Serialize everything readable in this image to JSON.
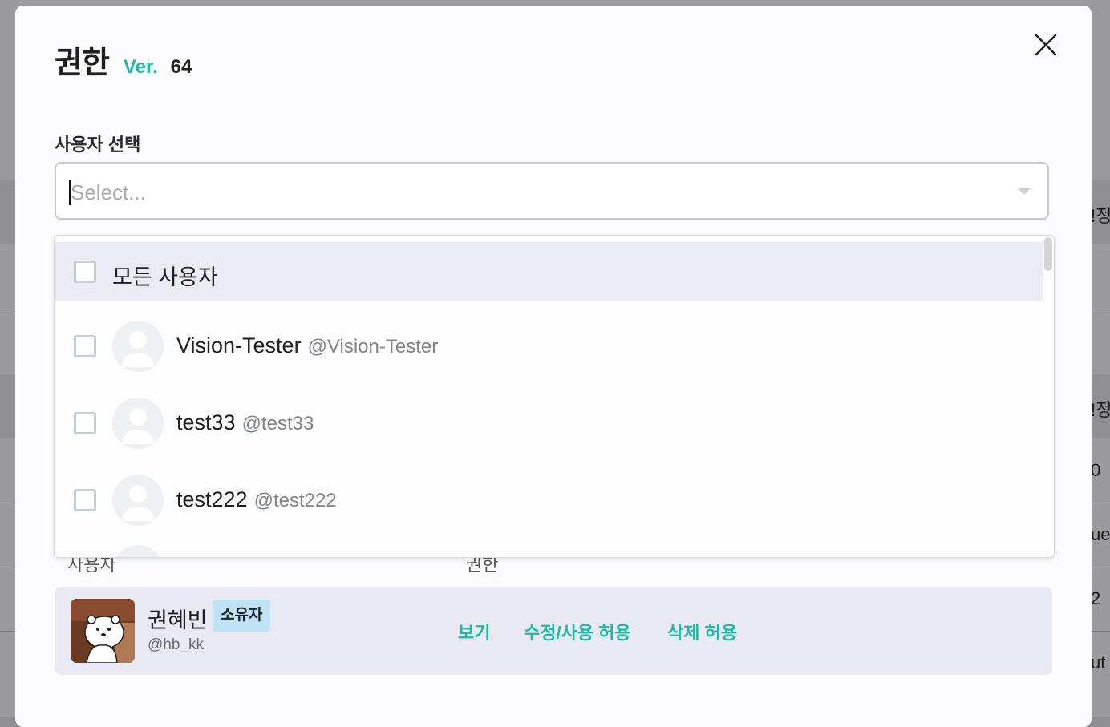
{
  "dialog": {
    "title": "권한",
    "version_label": "Ver.",
    "version_number": "64",
    "close_icon": "close-icon"
  },
  "user_select": {
    "label": "사용자 선택",
    "placeholder": "Select..."
  },
  "dropdown": {
    "all_users_label": "모든 사용자",
    "users": [
      {
        "name": "Vision-Tester",
        "handle": "@Vision-Tester"
      },
      {
        "name": "test33",
        "handle": "@test33"
      },
      {
        "name": "test222",
        "handle": "@test222"
      }
    ]
  },
  "permissions_table": {
    "col_user": "사용자",
    "col_permission": "권한",
    "owner": {
      "name": "권혜빈",
      "badge": "소유자",
      "handle": "@hb_kk",
      "permissions": [
        "보기",
        "수정/사용 허용",
        "삭제 허용"
      ]
    }
  },
  "background": {
    "fragments": [
      "!정",
      "!정",
      "0",
      "ue",
      "2",
      "ut"
    ]
  },
  "colors": {
    "accent": "#22b8a3",
    "badge_bg": "#bfe3f6",
    "highlight_row": "#ebebf4"
  }
}
